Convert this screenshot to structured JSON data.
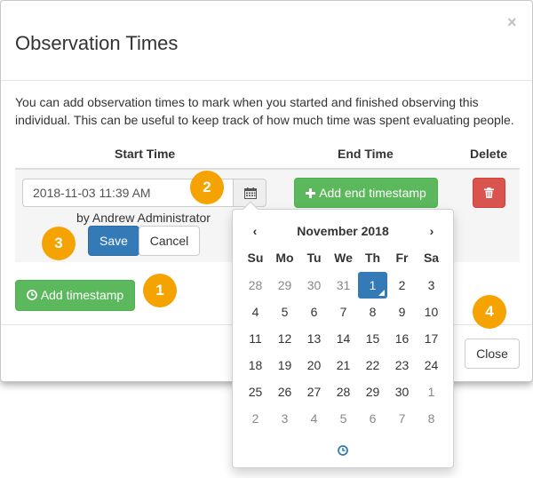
{
  "modal": {
    "title": "Observation Times",
    "close_symbol": "×",
    "description": "You can add observation times to mark when you started and finished observing this individual. This can be useful to keep track of how much time was spent evaluating people."
  },
  "table": {
    "headers": {
      "start": "Start Time",
      "end": "End Time",
      "delete": "Delete"
    },
    "row": {
      "start_value": "2018-11-03 11:39 AM",
      "byline": "by Andrew Administrator",
      "save_label": "Save",
      "cancel_label": "Cancel",
      "end_button_label": "Add end timestamp",
      "end_button_icon": "plus-icon",
      "delete_icon": "trash-icon"
    }
  },
  "actions": {
    "add_timestamp_label": "Add timestamp",
    "add_timestamp_icon": "clock-icon",
    "close_label": "Close"
  },
  "badges": [
    "1",
    "2",
    "3",
    "4"
  ],
  "datepicker": {
    "prev": "‹",
    "next": "›",
    "month": "November 2018",
    "weekdays": [
      "Su",
      "Mo",
      "Tu",
      "We",
      "Th",
      "Fr",
      "Sa"
    ],
    "weeks": [
      [
        "28",
        "29",
        "30",
        "31",
        "1",
        "2",
        "3"
      ],
      [
        "4",
        "5",
        "6",
        "7",
        "8",
        "9",
        "10"
      ],
      [
        "11",
        "12",
        "13",
        "14",
        "15",
        "16",
        "17"
      ],
      [
        "18",
        "19",
        "20",
        "21",
        "22",
        "23",
        "24"
      ],
      [
        "25",
        "26",
        "27",
        "28",
        "29",
        "30",
        "1"
      ],
      [
        "2",
        "3",
        "4",
        "5",
        "6",
        "7",
        "8"
      ]
    ],
    "muted_days": [
      [
        0,
        0
      ],
      [
        0,
        1
      ],
      [
        0,
        2
      ],
      [
        0,
        3
      ],
      [
        4,
        6
      ],
      [
        5,
        0
      ],
      [
        5,
        1
      ],
      [
        5,
        2
      ],
      [
        5,
        3
      ],
      [
        5,
        4
      ],
      [
        5,
        5
      ],
      [
        5,
        6
      ]
    ],
    "selected_day": [
      0,
      4
    ],
    "time_toggle_icon": "clock-icon"
  },
  "colors": {
    "primary": "#337ab7",
    "success": "#5cb85c",
    "danger": "#d9534f",
    "badge": "#f5a300"
  }
}
